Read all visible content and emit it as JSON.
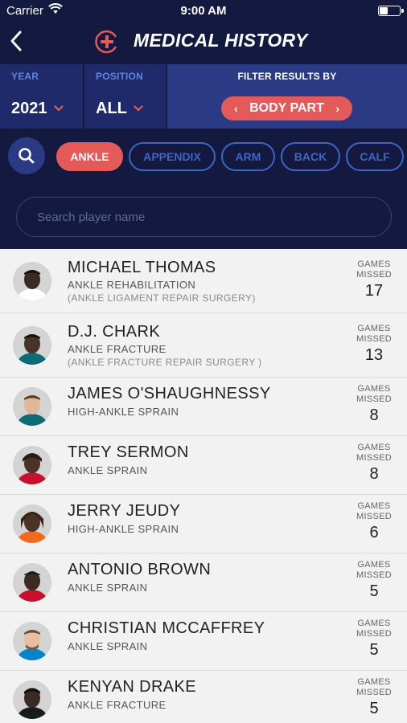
{
  "status_bar": {
    "carrier": "Carrier",
    "time": "9:00 AM"
  },
  "header": {
    "title": "MEDICAL HISTORY"
  },
  "filters": {
    "year_label": "YEAR",
    "year_value": "2021",
    "position_label": "POSITION",
    "position_value": "ALL",
    "filter_by_label": "FILTER RESULTS BY",
    "filter_by_value": "BODY PART"
  },
  "body_parts": [
    "ANKLE",
    "APPENDIX",
    "ARM",
    "BACK",
    "CALF"
  ],
  "search": {
    "placeholder": "Search player name"
  },
  "games_missed_label": [
    "GAMES",
    "MISSED"
  ],
  "players": [
    {
      "name": "MICHAEL THOMAS",
      "injury": "ANKLE REHABILITATION",
      "surgery": "(ANKLE LIGAMENT REPAIR SURGERY)",
      "games_missed": "17",
      "jersey_color": "#ffffff"
    },
    {
      "name": "D.J. CHARK",
      "injury": "ANKLE FRACTURE",
      "surgery": "(ANKLE FRACTURE REPAIR SURGERY )",
      "games_missed": "13",
      "jersey_color": "#0d6b75"
    },
    {
      "name": "JAMES O'SHAUGHNESSY",
      "injury": "HIGH-ANKLE SPRAIN",
      "surgery": "",
      "games_missed": "8",
      "jersey_color": "#0d6b75"
    },
    {
      "name": "TREY SERMON",
      "injury": "ANKLE SPRAIN",
      "surgery": "",
      "games_missed": "8",
      "jersey_color": "#c8102e"
    },
    {
      "name": "JERRY JEUDY",
      "injury": "HIGH-ANKLE SPRAIN",
      "surgery": "",
      "games_missed": "6",
      "jersey_color": "#f26a21"
    },
    {
      "name": "ANTONIO BROWN",
      "injury": "ANKLE SPRAIN",
      "surgery": "",
      "games_missed": "5",
      "jersey_color": "#c8102e"
    },
    {
      "name": "CHRISTIAN MCCAFFREY",
      "injury": "ANKLE SPRAIN",
      "surgery": "",
      "games_missed": "5",
      "jersey_color": "#0085ca"
    },
    {
      "name": "KENYAN DRAKE",
      "injury": "ANKLE FRACTURE",
      "surgery": "",
      "games_missed": "5",
      "jersey_color": "#1a1a1a"
    }
  ],
  "colors": {
    "navy": "#13193f",
    "accent_red": "#e35a58",
    "chip_blue": "#3f66c7"
  }
}
